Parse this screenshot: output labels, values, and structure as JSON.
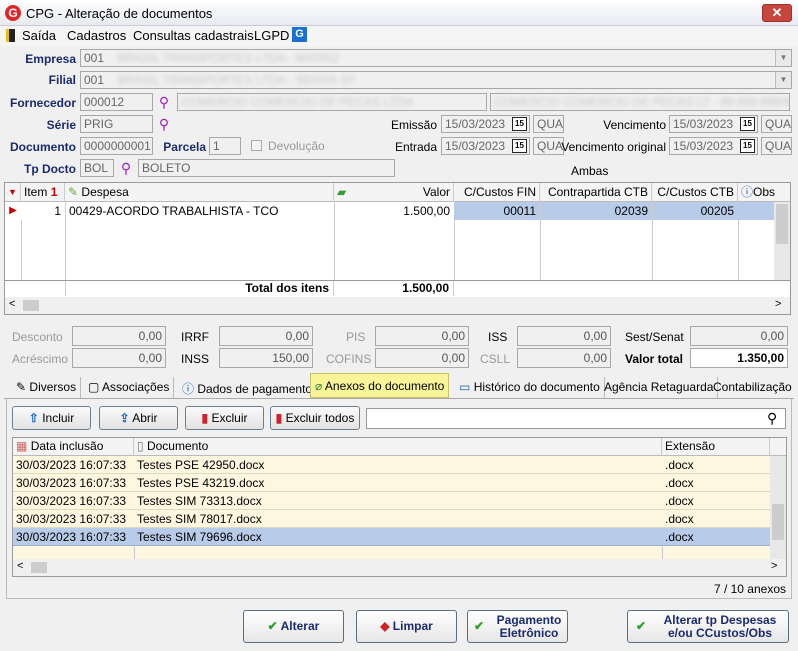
{
  "window": {
    "title": "CPG - Alteração de documentos",
    "close_label": "✕"
  },
  "menu": [
    "Saída",
    "Cadastros",
    "Consultas cadastrais",
    "LGPD"
  ],
  "form": {
    "empresa_label": "Empresa",
    "empresa_code": "001",
    "empresa_name": "BRASIL TRANSPORTES LTDA - MATRIZ",
    "filial_label": "Filial",
    "filial_code": "001",
    "filial_name": "BRASIL TRANSPORTES LTDA - SERRA SP",
    "fornecedor_label": "Fornecedor",
    "fornecedor_code": "000012",
    "fornecedor_name": "COMERCIO COMERCIO DE PECAS LTDA",
    "fornecedor_fantasia": "COMERCIO COMERCIO DE PECAS LT - 99.999.999/9999-99",
    "serie_label": "Série",
    "serie_value": "PRIG",
    "documento_label": "Documento",
    "documento_value": "0000000001",
    "parcela_label": "Parcela",
    "parcela_value": "1",
    "devolucao_label": "Devolução",
    "tpdocto_label": "Tp Docto",
    "tpdocto_code": "BOL",
    "tpdocto_name": "BOLETO",
    "emissao_label": "Emissão",
    "emissao_value": "15/03/2023",
    "emissao_day": "QUA",
    "entrada_label": "Entrada",
    "entrada_value": "15/03/2023",
    "entrada_day": "QUA",
    "vencimento_label": "Vencimento",
    "vencimento_value": "15/03/2023",
    "vencimento_day": "QUA",
    "venc_original_label": "Vencimento original",
    "venc_original_value": "15/03/2023",
    "venc_original_day": "QUA",
    "ambas_label": "Ambas",
    "cal_icon": "15"
  },
  "items_grid": {
    "headers": {
      "item": "Item",
      "sort": "1",
      "despesa": "Despesa",
      "valor": "Valor",
      "cc_fin": "C/Custos FIN",
      "contrapartida": "Contrapartida CTB",
      "cc_ctb": "C/Custos CTB",
      "obs": "Obs"
    },
    "rows": [
      {
        "item": "1",
        "despesa": "00429-ACORDO TRABALHISTA - TCO",
        "valor": "1.500,00",
        "cc_fin": "00011",
        "contrapartida": "02039",
        "cc_ctb": "00205"
      }
    ],
    "total_label": "Total dos itens",
    "total_value": "1.500,00"
  },
  "summary": {
    "desconto_label": "Desconto",
    "desconto": "0,00",
    "acrescimo_label": "Acréscimo",
    "acrescimo": "0,00",
    "irrf_label": "IRRF",
    "irrf": "0,00",
    "inss_label": "INSS",
    "inss": "150,00",
    "pis_label": "PIS",
    "pis": "0,00",
    "cofins_label": "COFINS",
    "cofins": "0,00",
    "iss_label": "ISS",
    "iss": "0,00",
    "csll_label": "CSLL",
    "csll": "0,00",
    "sest_label": "Sest/Senat",
    "sest": "0,00",
    "valor_total_label": "Valor total",
    "valor_total": "1.350,00"
  },
  "tabs": [
    "Diversos",
    "Associações",
    "Dados de pagamento",
    "Anexos do documento",
    "Histórico do documento",
    "Agência Retaguarda",
    "Contabilização"
  ],
  "attach_toolbar": {
    "incluir": "Incluir",
    "abrir": "Abrir",
    "excluir": "Excluir",
    "excluir_todos": "Excluir todos",
    "search_placeholder": ""
  },
  "attach_grid": {
    "headers": {
      "data": "Data inclusão",
      "documento": "Documento",
      "extensao": "Extensão"
    },
    "rows": [
      {
        "data": "30/03/2023 16:07:33",
        "documento": "Testes PSE 42950.docx",
        "extensao": ".docx"
      },
      {
        "data": "30/03/2023 16:07:33",
        "documento": "Testes PSE 43219.docx",
        "extensao": ".docx"
      },
      {
        "data": "30/03/2023 16:07:33",
        "documento": "Testes SIM 73313.docx",
        "extensao": ".docx"
      },
      {
        "data": "30/03/2023 16:07:33",
        "documento": "Testes SIM 78017.docx",
        "extensao": ".docx"
      },
      {
        "data": "30/03/2023 16:07:33",
        "documento": "Testes SIM 79696.docx",
        "extensao": ".docx"
      }
    ],
    "count": "7 / 10 anexos"
  },
  "buttons": {
    "alterar": "Alterar",
    "limpar": "Limpar",
    "pagamento_1": "Pagamento",
    "pagamento_2": "Eletrônico",
    "tp_1": "Alterar tp Despesas",
    "tp_2": "e/ou CCustos/Obs"
  },
  "colors": {
    "accent": "#1a2a6e",
    "selected_row": "#b8cbe8",
    "active_tab": "#f8f599",
    "alt_row": "#fff6e0"
  }
}
